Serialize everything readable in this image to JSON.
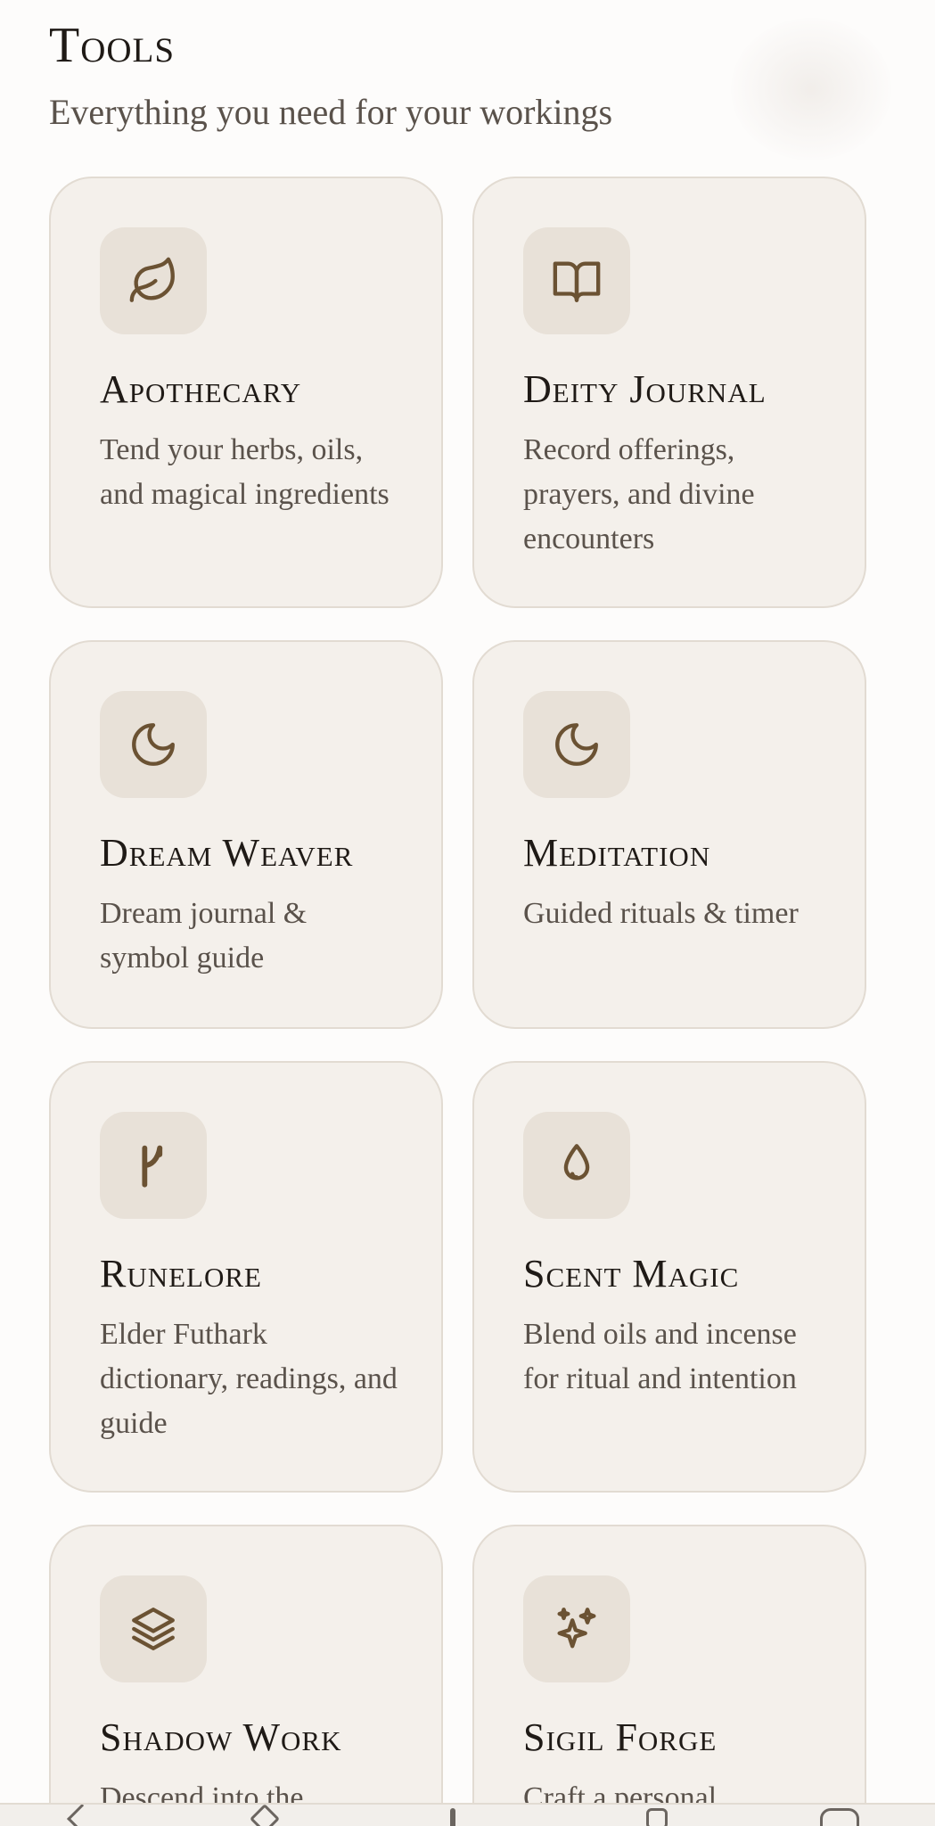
{
  "header": {
    "title": "Tools",
    "subtitle": "Everything you need for your workings"
  },
  "tools": [
    {
      "title": "Apothecary",
      "description": "Tend your herbs, oils, and magical ingredients",
      "icon": "leaf-icon"
    },
    {
      "title": "Deity Journal",
      "description": "Record offerings, prayers, and divine encounters",
      "icon": "book-open-icon"
    },
    {
      "title": "Dream Weaver",
      "description": "Dream journal & symbol guide",
      "icon": "moon-icon"
    },
    {
      "title": "Meditation",
      "description": "Guided rituals & timer",
      "icon": "moon-icon"
    },
    {
      "title": "Runelore",
      "description": "Elder Futhark dictionary, readings, and guide",
      "icon": "rune-icon"
    },
    {
      "title": "Scent Magic",
      "description": "Blend oils and incense for ritual and intention",
      "icon": "droplet-icon"
    },
    {
      "title": "Shadow Work",
      "description": "Descend into the",
      "icon": "layers-icon"
    },
    {
      "title": "Sigil Forge",
      "description": "Craft a personal",
      "icon": "sparkles-icon"
    }
  ],
  "colors": {
    "card_background": "#f4f0eb",
    "card_border": "#e2dbd2",
    "icon_tile": "#e8e1d8",
    "icon_stroke": "#6b5233"
  }
}
